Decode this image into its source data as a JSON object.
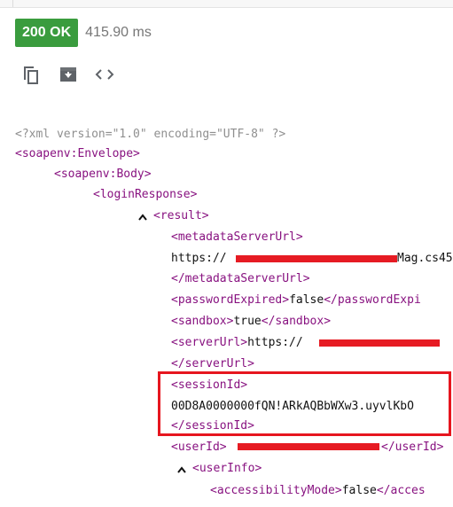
{
  "response": {
    "status": "200 OK",
    "time": "415.90 ms",
    "status_color": "#3a9c3e"
  },
  "toolbar": {
    "copy_icon": "copy-icon",
    "download_icon": "download-icon",
    "code_icon": "code-view-icon"
  },
  "xml": {
    "declaration": "<?xml version=\"1.0\" encoding=\"UTF-8\" ?>",
    "envelope_open": "<soapenv:Envelope>",
    "body_open": "<soapenv:Body>",
    "login_response_open": "<loginResponse>",
    "result_open": "<result>",
    "metadata_open": "<metadataServerUrl>",
    "metadata_value_prefix": "https://",
    "metadata_value_suffix": "Mag.cs45",
    "metadata_close": "</metadataServerUrl>",
    "password_expired_open": "<passwordExpired>",
    "password_expired_value": "false",
    "password_expired_close": "</passwordExpi",
    "sandbox_open": "<sandbox>",
    "sandbox_value": "true",
    "sandbox_close": "</sandbox>",
    "server_url_open": "<serverUrl>",
    "server_url_value_prefix": "https://",
    "server_url_close": "</serverUrl>",
    "session_id_open": "<sessionId>",
    "session_id_value": "00D8A0000000fQN!ARkAQBbWXw3.uyvlKbO",
    "session_id_close": "</sessionId>",
    "user_id_open": "<userId>",
    "user_id_close": "</userId>",
    "user_info_open": "<userInfo>",
    "accessibility_open": "<accessibilityMode>",
    "accessibility_value": "false",
    "accessibility_close": "</acces"
  },
  "colors": {
    "tag": "#881280",
    "redaction": "#e61b23",
    "highlight": "#e6161f"
  }
}
